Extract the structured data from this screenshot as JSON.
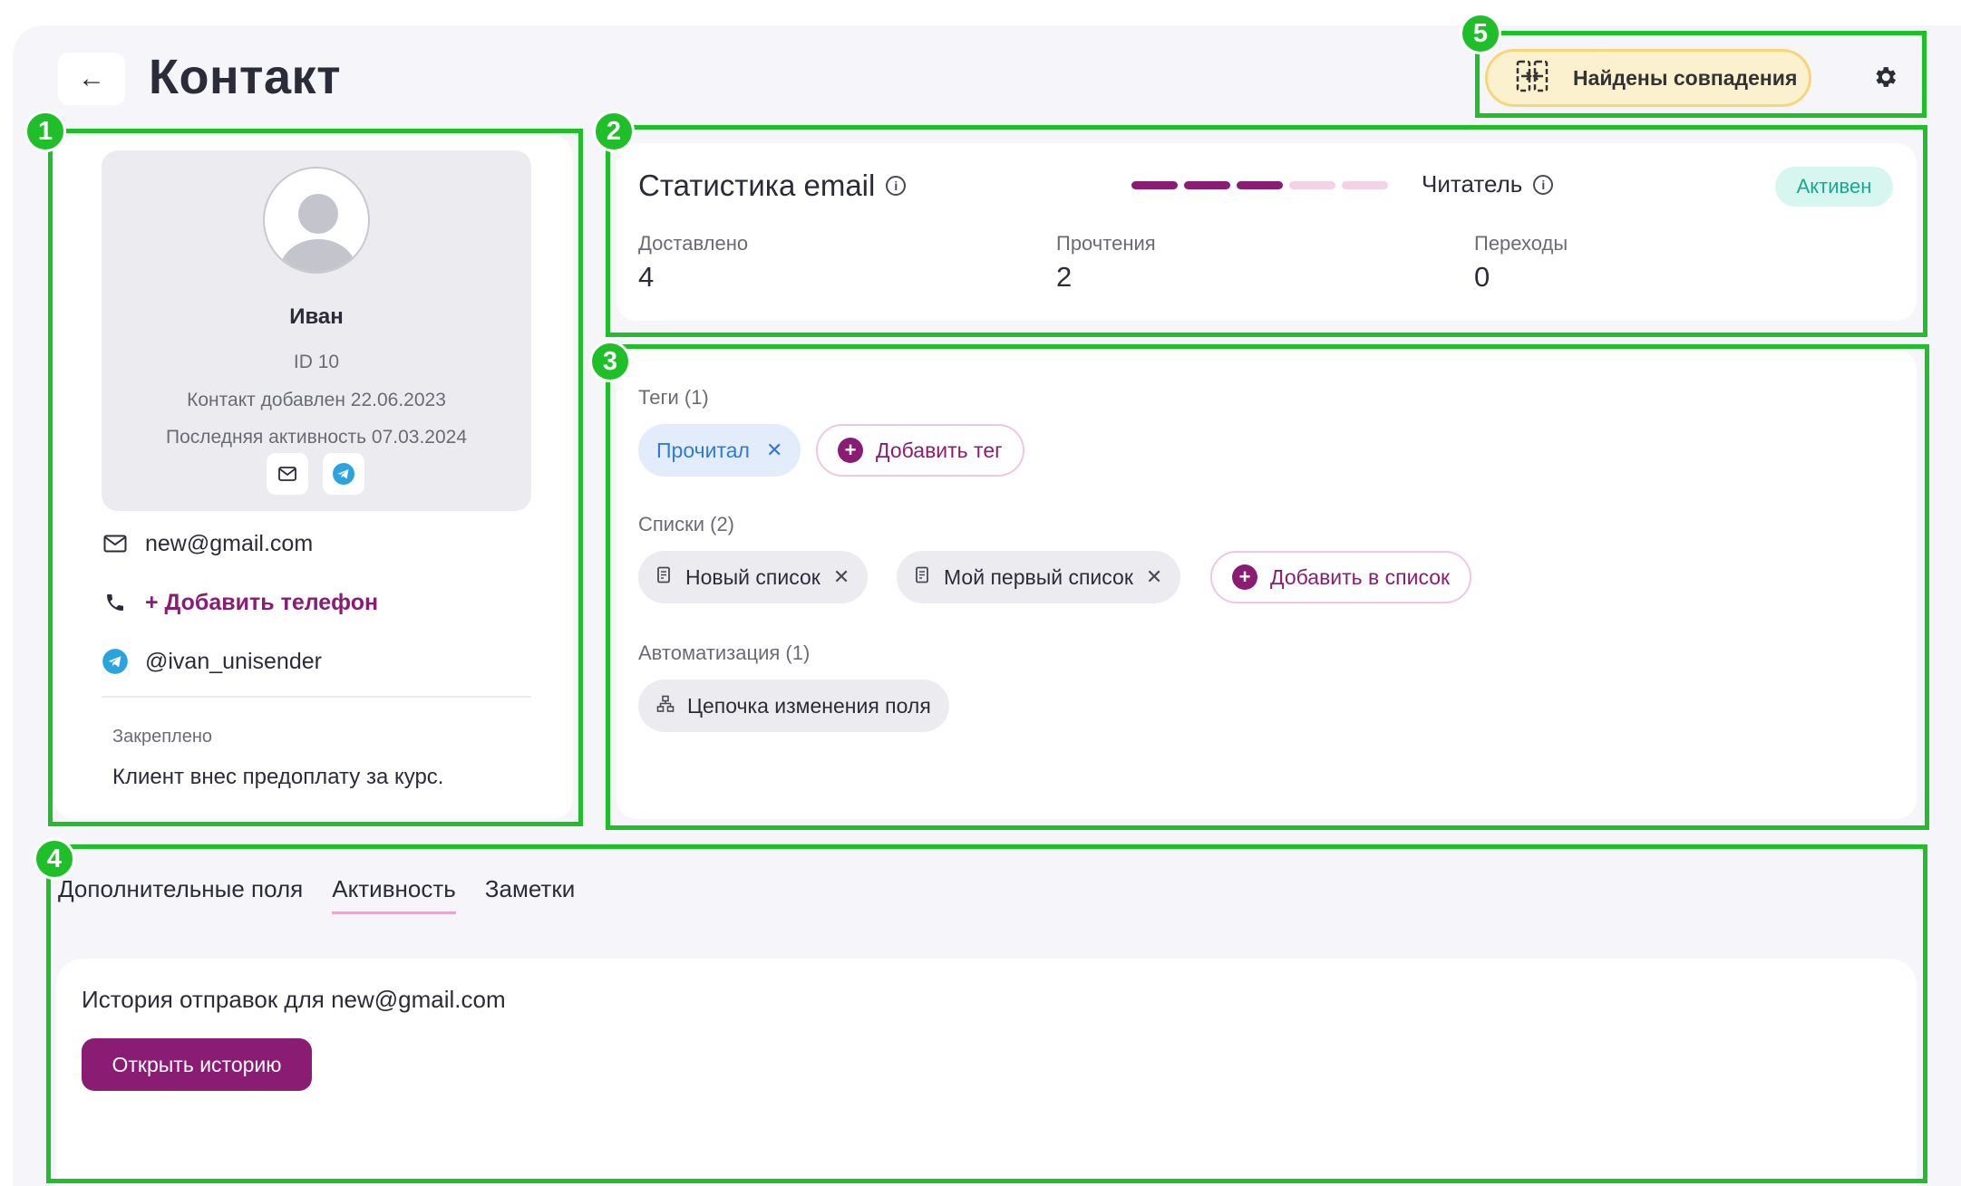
{
  "header": {
    "back_icon": "arrow-left-icon",
    "title": "Контакт",
    "match_chip_label": "Найдены совпадения",
    "match_icon": "merge-icon",
    "settings_icon": "gear-icon"
  },
  "annotations": [
    "1",
    "2",
    "3",
    "4",
    "5"
  ],
  "profile": {
    "name": "Иван",
    "id_line": "ID 10",
    "added_line": "Контакт добавлен 22.06.2023",
    "activity_line": "Последняя активность 07.03.2024",
    "email": "new@gmail.com",
    "add_phone": "+ Добавить телефон",
    "telegram": "@ivan_unisender",
    "pinned_label": "Закреплено",
    "pinned_text": "Клиент внес предоплату за курс."
  },
  "stats": {
    "title": "Статистика email",
    "reader_label": "Читатель",
    "status_badge": "Активен",
    "level": 3,
    "level_max": 5,
    "level_colors": [
      "#8b1c74",
      "#f3d2e8"
    ],
    "items": [
      {
        "label": "Доставлено",
        "value": "4"
      },
      {
        "label": "Прочтения",
        "value": "2"
      },
      {
        "label": "Переходы",
        "value": "0"
      }
    ]
  },
  "tags": {
    "tags_label": "Теги (1)",
    "tag_items": [
      "Прочитал"
    ],
    "add_tag": "Добавить тег",
    "lists_label": "Списки (2)",
    "list_items": [
      "Новый список",
      "Мой первый список"
    ],
    "add_list": "Добавить в список",
    "automation_label": "Автоматизация (1)",
    "automation_items": [
      "Цепочка изменения поля"
    ]
  },
  "tabs": [
    {
      "label": "Дополнительные поля",
      "active": false
    },
    {
      "label": "Активность",
      "active": true
    },
    {
      "label": "Заметки",
      "active": false
    }
  ],
  "history": {
    "title": "История отправок для new@gmail.com",
    "button": "Открыть историю"
  },
  "colors": {
    "accent": "#8b1c74",
    "annotation": "#1fbf2a",
    "active_badge_bg": "#d6f6ef",
    "active_badge_text": "#1aa98f",
    "match_chip_bg": "#fbf1cf"
  }
}
